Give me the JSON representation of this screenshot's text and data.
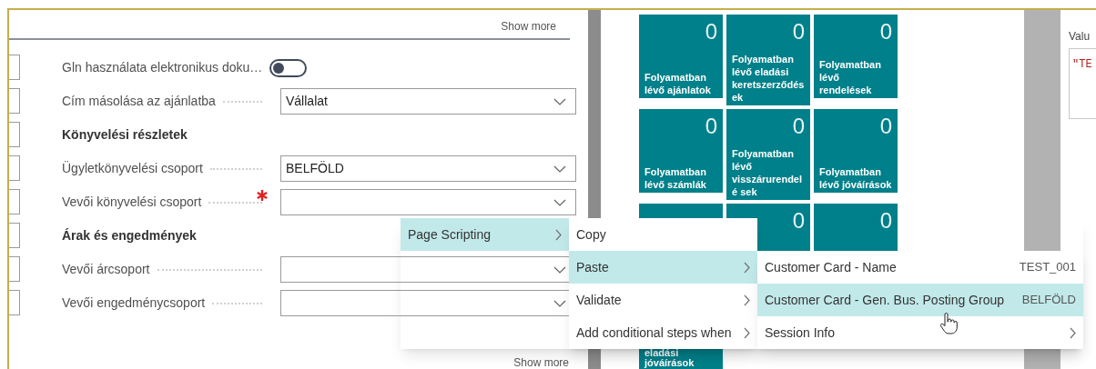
{
  "panel": {
    "show_more_top": "Show more",
    "show_more_bottom": "Show more",
    "rows": [
      {
        "kind": "toggle",
        "label": "Gln használata elektronikus doku…",
        "on": false
      },
      {
        "kind": "select",
        "label": "Cím másolása az ajánlatba",
        "value": "Vállalat",
        "required": false
      },
      {
        "kind": "heading",
        "label": "Könyvelési részletek"
      },
      {
        "kind": "select",
        "label": "Ügyletkönyvelési csoport",
        "value": "BELFÖLD",
        "required": false
      },
      {
        "kind": "select",
        "label": "Vevői könyvelési csoport",
        "required": true
      },
      {
        "kind": "heading",
        "label": "Árak és engedmények"
      },
      {
        "kind": "select",
        "label": "Vevői árcsoport",
        "required": false
      },
      {
        "kind": "select",
        "label": "Vevői engedménycsoport",
        "required": false
      }
    ]
  },
  "tiles": [
    [
      {
        "value": "0",
        "label": "Folyamatban lévő ajánlatok"
      },
      {
        "value": "0",
        "label": "Folyamatban lévő eladási keretszerződés ek"
      },
      {
        "value": "0",
        "label": "Folyamatban lévő rendelések"
      }
    ],
    [
      {
        "value": "0",
        "label": "Folyamatban lévő számlák"
      },
      {
        "value": "0",
        "label": "Folyamatban lévő visszárurendelé sek"
      },
      {
        "value": "0",
        "label": "Folyamatban lévő jóváírások"
      }
    ],
    [
      {
        "label": "eladási jóváírások"
      },
      {
        "value": "0"
      },
      {
        "value": "0"
      }
    ]
  ],
  "right_panel": {
    "label": "Valu",
    "value": "\"TE"
  },
  "context_menu": {
    "items": [
      {
        "label": "Page Scripting",
        "selected": true,
        "has_submenu": true
      }
    ],
    "submenu": [
      {
        "label": "Copy",
        "selected": false,
        "has_submenu": false
      },
      {
        "label": "Paste",
        "selected": true,
        "has_submenu": true
      },
      {
        "label": "Validate",
        "selected": false,
        "has_submenu": true
      },
      {
        "label": "Add conditional steps when",
        "selected": false,
        "has_submenu": true
      }
    ],
    "paste_menu": [
      {
        "label": "Customer Card - Name",
        "value": "TEST_001",
        "selected": false,
        "has_submenu": false
      },
      {
        "label": "Customer Card - Gen. Bus. Posting Group",
        "value": "BELFÖLD",
        "selected": true,
        "has_submenu": false
      },
      {
        "label": "Session Info",
        "selected": false,
        "has_submenu": true
      }
    ]
  }
}
